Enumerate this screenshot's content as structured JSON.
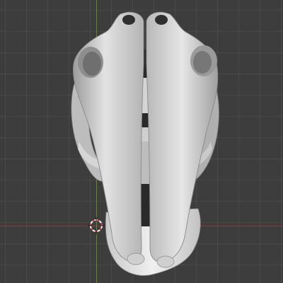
{
  "viewport": {
    "background_color": "#3d3d3d",
    "grid_color": "#4a4a4a",
    "x_axis_color": "#8a3a44",
    "y_axis_color": "#5f8a2a",
    "object": "skull-mesh",
    "cursor_icon": "3d-cursor-icon"
  }
}
